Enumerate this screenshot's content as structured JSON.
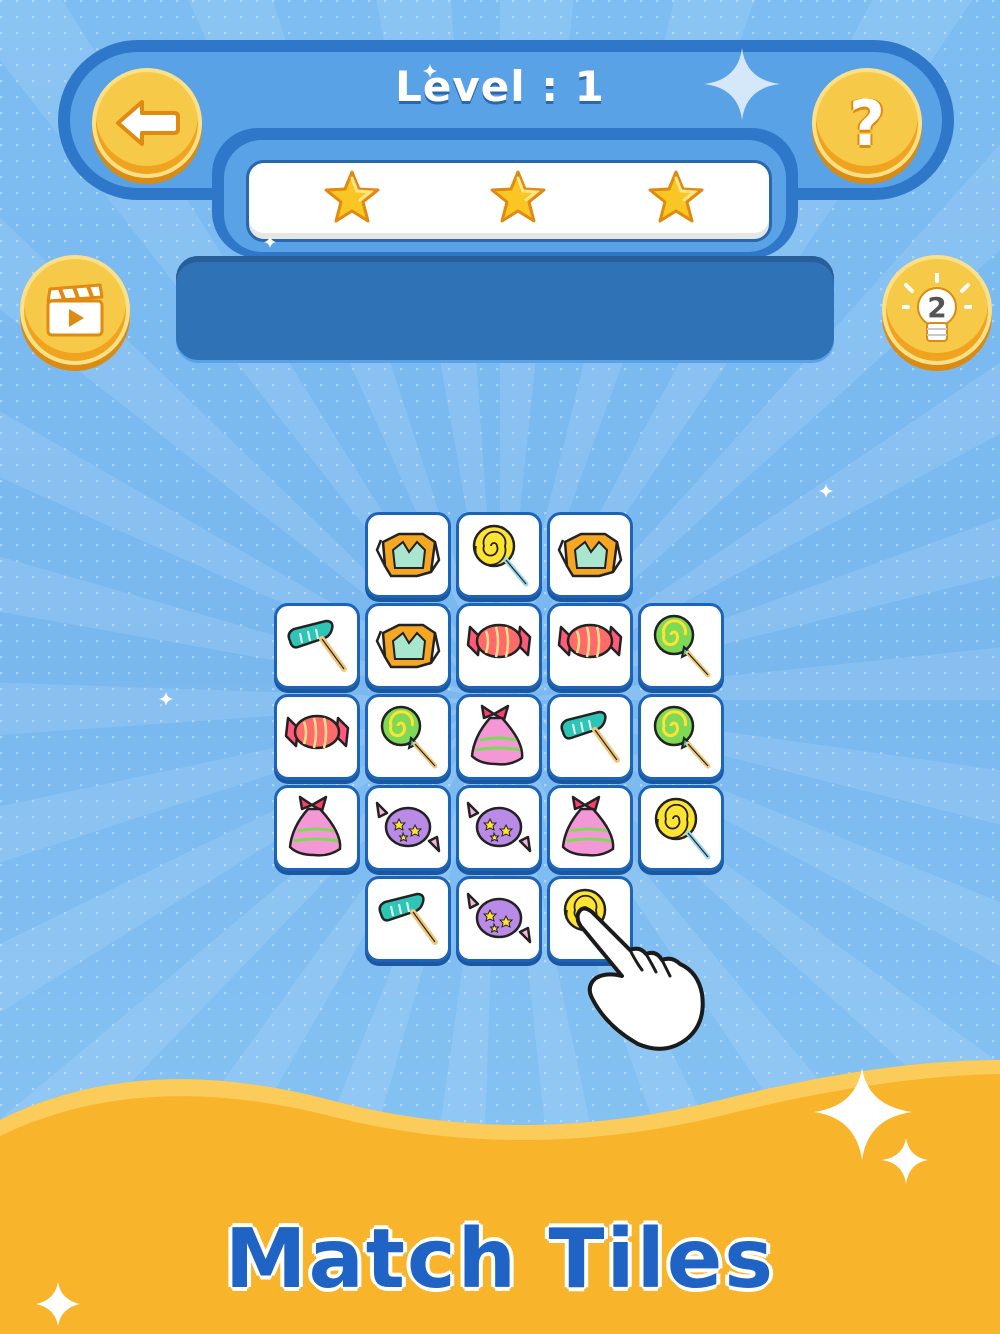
{
  "header": {
    "level_label": "Level : 1",
    "stars_count": 3
  },
  "buttons": {
    "back_icon": "arrow-left-icon",
    "help_icon": "question-icon",
    "help_symbol": "?",
    "video_icon": "clapperboard-icon",
    "hint_icon": "lightbulb-icon",
    "hint_count": "2"
  },
  "board": {
    "tiles": [
      {
        "row": 0,
        "col": 1,
        "type": "wrapped-candy-orange"
      },
      {
        "row": 0,
        "col": 2,
        "type": "swirl-lollipop-yellow"
      },
      {
        "row": 0,
        "col": 3,
        "type": "wrapped-candy-orange"
      },
      {
        "row": 1,
        "col": 0,
        "type": "popsicle-teal"
      },
      {
        "row": 1,
        "col": 1,
        "type": "wrapped-candy-orange"
      },
      {
        "row": 1,
        "col": 2,
        "type": "striped-candy-red"
      },
      {
        "row": 1,
        "col": 3,
        "type": "striped-candy-red"
      },
      {
        "row": 1,
        "col": 4,
        "type": "spiral-lollipop-green"
      },
      {
        "row": 2,
        "col": 0,
        "type": "striped-candy-red"
      },
      {
        "row": 2,
        "col": 1,
        "type": "spiral-lollipop-green"
      },
      {
        "row": 2,
        "col": 2,
        "type": "bag-candy-pink"
      },
      {
        "row": 2,
        "col": 3,
        "type": "popsicle-teal"
      },
      {
        "row": 2,
        "col": 4,
        "type": "spiral-lollipop-green"
      },
      {
        "row": 3,
        "col": 0,
        "type": "bag-candy-pink"
      },
      {
        "row": 3,
        "col": 1,
        "type": "star-candy-purple"
      },
      {
        "row": 3,
        "col": 2,
        "type": "star-candy-purple"
      },
      {
        "row": 3,
        "col": 3,
        "type": "bag-candy-pink"
      },
      {
        "row": 3,
        "col": 4,
        "type": "swirl-lollipop-yellow"
      },
      {
        "row": 4,
        "col": 1,
        "type": "popsicle-teal"
      },
      {
        "row": 4,
        "col": 2,
        "type": "star-candy-purple"
      },
      {
        "row": 4,
        "col": 3,
        "type": "swirl-lollipop-yellow"
      }
    ]
  },
  "pointer_icon": "pointing-hand-icon",
  "caption": "Match Tiles",
  "colors": {
    "background": "#7dbdf2",
    "panel_dark": "#2f78c9",
    "button_gold": "#f7c948",
    "wave_orange": "#f8b52c",
    "caption_blue": "#1f63c4"
  }
}
